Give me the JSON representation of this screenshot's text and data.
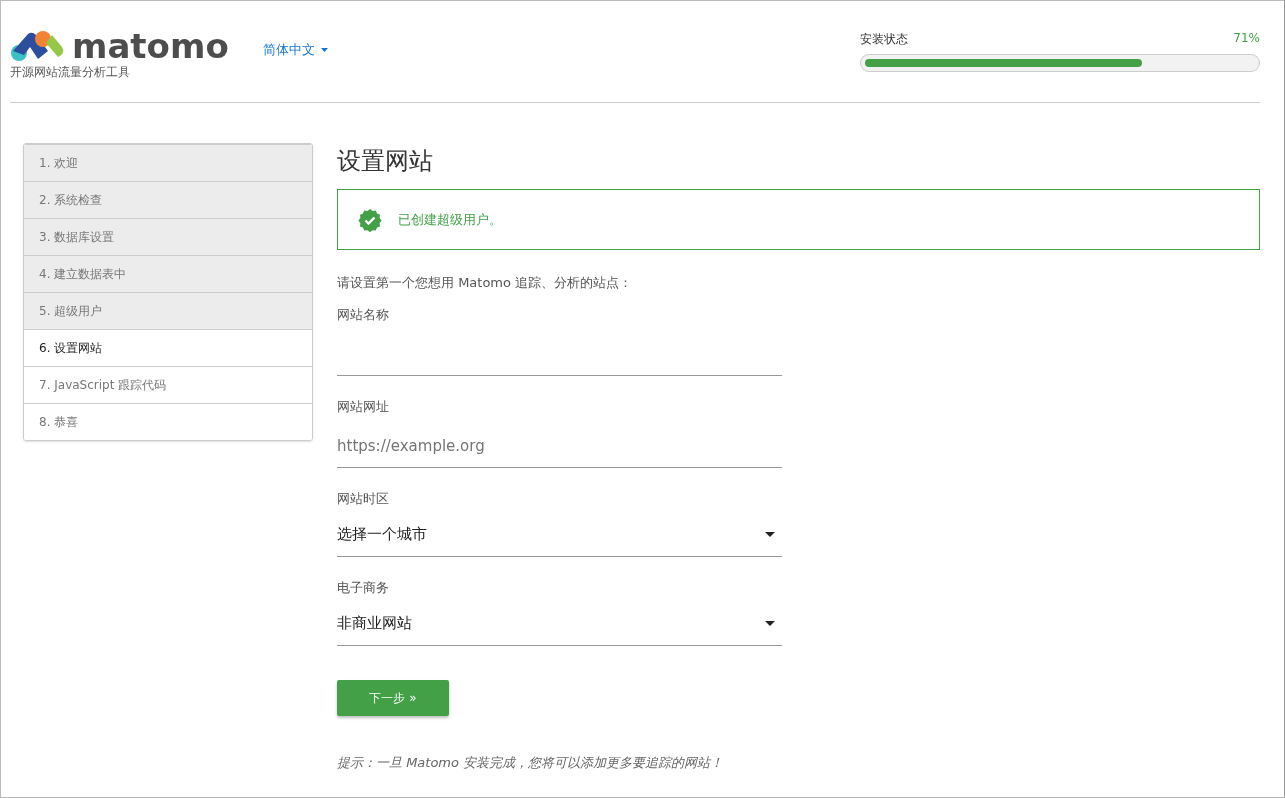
{
  "header": {
    "logo": "matomo",
    "tagline": "开源网站流量分析工具",
    "language": "简体中文",
    "progress": {
      "label": "安装状态",
      "reading": "71%",
      "level": 0.71
    }
  },
  "steps": [
    {
      "label": "1. 欢迎",
      "done": true,
      "selected": false
    },
    {
      "label": "2. 系统检查",
      "done": true,
      "selected": false
    },
    {
      "label": "3. 数据库设置",
      "done": true,
      "selected": false
    },
    {
      "label": "4. 建立数据表中",
      "done": true,
      "selected": false
    },
    {
      "label": "5. 超级用户",
      "done": true,
      "selected": false
    },
    {
      "label": "6. 设置网站",
      "done": false,
      "selected": true
    },
    {
      "label": "7. JavaScript 跟踪代码",
      "done": false,
      "selected": false
    },
    {
      "label": "8. 恭喜",
      "done": false,
      "selected": false
    }
  ],
  "main": {
    "title": "设置网站",
    "notice": "已创建超级用户。",
    "intro": "请设置第一个您想用 Matomo 追踪、分析的站点：",
    "fields": [
      {
        "kind": "text",
        "label": "网站名称"
      },
      {
        "kind": "text",
        "label": "网站网址",
        "placeholder": "https://example.org"
      },
      {
        "kind": "select",
        "label": "网站时区",
        "value": "选择一个城市"
      },
      {
        "kind": "select",
        "label": "电子商务",
        "value": "非商业网站"
      }
    ],
    "button": "下一步 »",
    "hint": "提示：一旦 Matomo 安装完成，您将可以添加更多要追踪的网站！"
  }
}
